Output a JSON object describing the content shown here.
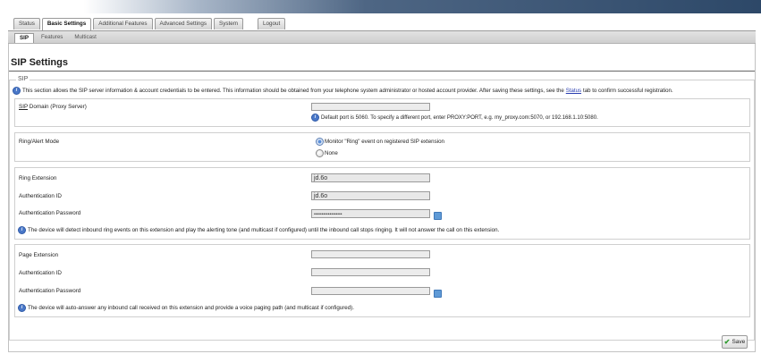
{
  "tabs": [
    {
      "label": "Status",
      "active": false
    },
    {
      "label": "Basic Settings",
      "active": true
    },
    {
      "label": "Additional Features",
      "active": false
    },
    {
      "label": "Advanced Settings",
      "active": false
    },
    {
      "label": "System",
      "active": false
    },
    {
      "label": "Logout",
      "active": false
    }
  ],
  "subtabs": [
    {
      "label": "SIP",
      "active": true
    },
    {
      "label": "Features",
      "active": false
    },
    {
      "label": "Multicast",
      "active": false
    }
  ],
  "page": {
    "title": "SIP Settings",
    "legend": "SIP",
    "info_before": "This section allows the SIP server information & account credentials to be entered. This information should be obtained from your telephone system administrator or hosted account provider. After saving these settings, see the",
    "info_link": "Status",
    "info_after": "tab to confirm successful registration."
  },
  "sip_domain": {
    "label_abbr": "SIP",
    "label_rest": " Domain (Proxy Server)",
    "value": "",
    "hint": "Default port is 5060. To specify a different port, enter PROXY:PORT, e.g. my_proxy.com:5070, or 192.168.1.10:5080."
  },
  "ring_mode": {
    "label": "Ring/Alert Mode",
    "options": [
      {
        "label": "Monitor \"Ring\" event on registered SIP extension",
        "checked": true
      },
      {
        "label": "None",
        "checked": false
      }
    ]
  },
  "ring": {
    "ext_label": "Ring Extension",
    "ext_value": "jd.6o",
    "auth_label": "Authentication ID",
    "auth_value": "jd.6o",
    "pass_label": "Authentication Password",
    "pass_value": "••••••••••••••••••",
    "note": "The device will detect inbound ring events on this extension and play the alerting tone (and multicast if configured) until the inbound call stops ringing. It will not answer the call on this extension."
  },
  "page_ext": {
    "ext_label": "Page Extension",
    "ext_value": "",
    "auth_label": "Authentication ID",
    "auth_value": "",
    "pass_label": "Authentication Password",
    "pass_value": "",
    "note": "The device will auto-answer any inbound call received on this extension and provide a voice paging path (and multicast if configured)."
  },
  "save_label": "Save",
  "icons": {
    "info": "info-icon",
    "key": "key-icon",
    "save": "checkmark-icon"
  },
  "colors": {
    "banner": "#2d4868",
    "info_icon": "#4a78c8",
    "save_check": "#2e9a2e"
  }
}
